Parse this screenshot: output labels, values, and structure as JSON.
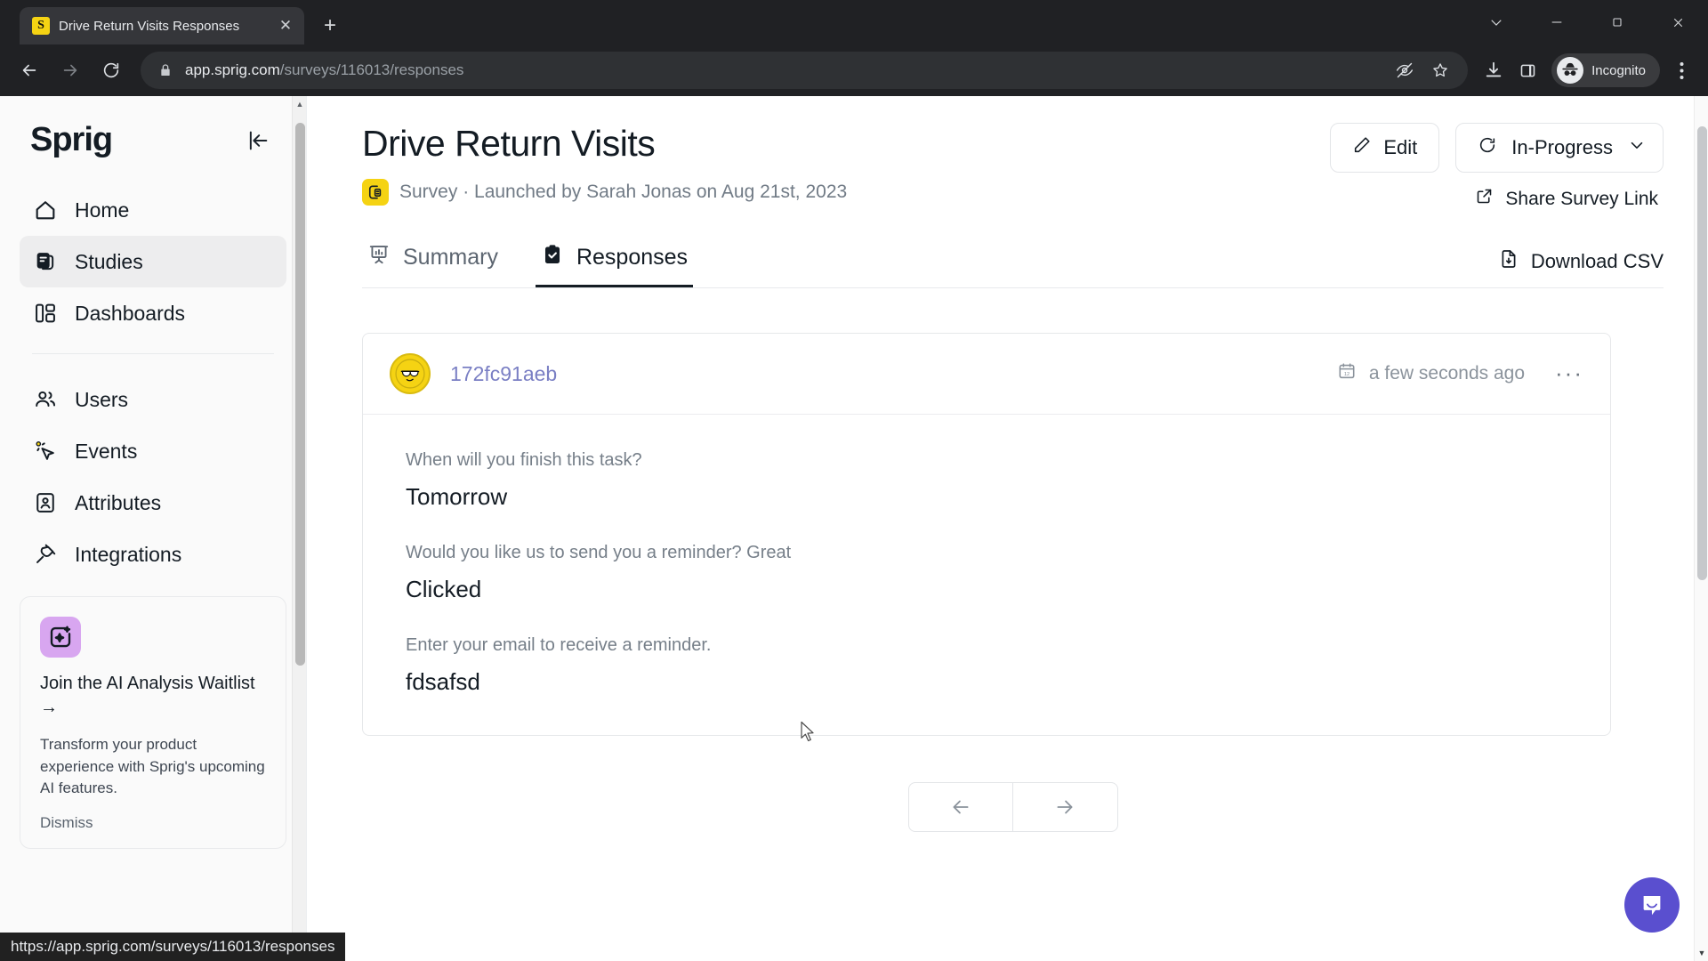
{
  "browser": {
    "tab": {
      "title": "Drive Return Visits Responses",
      "favicon_letter": "S",
      "favicon_color": "#F5D313",
      "close_label": "✕"
    },
    "newtab_label": "+",
    "window_controls": [
      "chevron-down",
      "minimize",
      "maximize",
      "close"
    ],
    "nav": {
      "back": "←",
      "forward": "→",
      "reload": "⟳"
    },
    "address": {
      "domain": "app.sprig.com",
      "path": "/surveys/116013/responses",
      "full": "app.sprig.com/surveys/116013/responses"
    },
    "profile_label": "Incognito",
    "status_url": "https://app.sprig.com/surveys/116013/responses"
  },
  "sidebar": {
    "logo": "Sprig",
    "collapse_label": "collapse-sidebar",
    "items": [
      {
        "label": "Home",
        "icon": "home-icon",
        "active": false
      },
      {
        "label": "Studies",
        "icon": "studies-icon",
        "active": true
      },
      {
        "label": "Dashboards",
        "icon": "dashboards-icon",
        "active": false
      },
      {
        "label": "Users",
        "icon": "users-icon",
        "active": false
      },
      {
        "label": "Events",
        "icon": "events-icon",
        "active": false
      },
      {
        "label": "Attributes",
        "icon": "attributes-icon",
        "active": false
      },
      {
        "label": "Integrations",
        "icon": "integrations-icon",
        "active": false
      }
    ],
    "ai_card": {
      "title": "Join the AI Analysis Waitlist →",
      "body": "Transform your product experience with Sprig's upcoming AI features.",
      "dismiss": "Dismiss",
      "badge_color": "#d8a6f0"
    }
  },
  "main": {
    "page_title": "Drive Return Visits",
    "subtitle": "Survey · Launched by Sarah Jonas on Aug 21st, 2023",
    "edit_label": "Edit",
    "status_label": "In-Progress",
    "share_label": "Share Survey Link",
    "download_label": "Download CSV",
    "tabs": [
      {
        "label": "Summary",
        "icon": "chart-presentation-icon",
        "active": false
      },
      {
        "label": "Responses",
        "icon": "clipboard-check-icon",
        "active": true
      }
    ],
    "response": {
      "id": "172fc91aeb",
      "id_color": "#7a7fc4",
      "timestamp": "a few seconds ago",
      "more_label": "···",
      "qa": [
        {
          "question": "When will you finish this task?",
          "answer": "Tomorrow"
        },
        {
          "question": "Would you like us to send you a reminder? Great",
          "answer": "Clicked"
        },
        {
          "question": "Enter your email to receive a reminder.",
          "answer": "fdsafsd"
        }
      ]
    },
    "pagination": {
      "prev": "←",
      "next": "→"
    },
    "chat_color": "#5a4fcf"
  }
}
